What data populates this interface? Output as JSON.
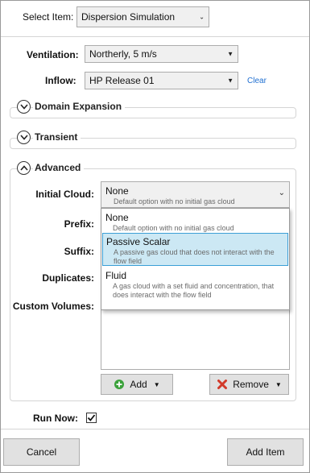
{
  "header": {
    "select_item_label": "Select Item:",
    "select_item_value": "Dispersion Simulation"
  },
  "fields": {
    "ventilation_label": "Ventilation:",
    "ventilation_value": "Northerly, 5 m/s",
    "inflow_label": "Inflow:",
    "inflow_value": "HP Release 01",
    "clear_link": "Clear"
  },
  "sections": {
    "domain_expansion": "Domain Expansion",
    "transient": "Transient",
    "advanced": "Advanced"
  },
  "advanced": {
    "initial_cloud_label": "Initial Cloud:",
    "initial_cloud_value": "None",
    "initial_cloud_desc": "Default option with no initial gas cloud",
    "prefix_label": "Prefix:",
    "suffix_label": "Suffix:",
    "duplicates_label": "Duplicates:",
    "custom_volumes_label": "Custom Volumes:",
    "add_button": "Add",
    "remove_button": "Remove"
  },
  "dropdown_options": [
    {
      "title": "None",
      "desc": "Default option with no initial gas cloud",
      "selected": false
    },
    {
      "title": "Passive Scalar",
      "desc": "A passive gas cloud that does not interact with the flow field",
      "selected": true
    },
    {
      "title": "Fluid",
      "desc": "A gas cloud with a set fluid and concentration, that does interact with the flow field",
      "selected": false
    }
  ],
  "footer": {
    "run_now_label": "Run Now:",
    "run_now_checked": true,
    "cancel_button": "Cancel",
    "add_item_button": "Add Item"
  },
  "colors": {
    "link": "#1f6fd1",
    "selected_option_bg": "#cce8f4",
    "selected_option_border": "#3c9fd6",
    "add_icon": "#3aa13a",
    "remove_icon": "#d23a2a"
  }
}
